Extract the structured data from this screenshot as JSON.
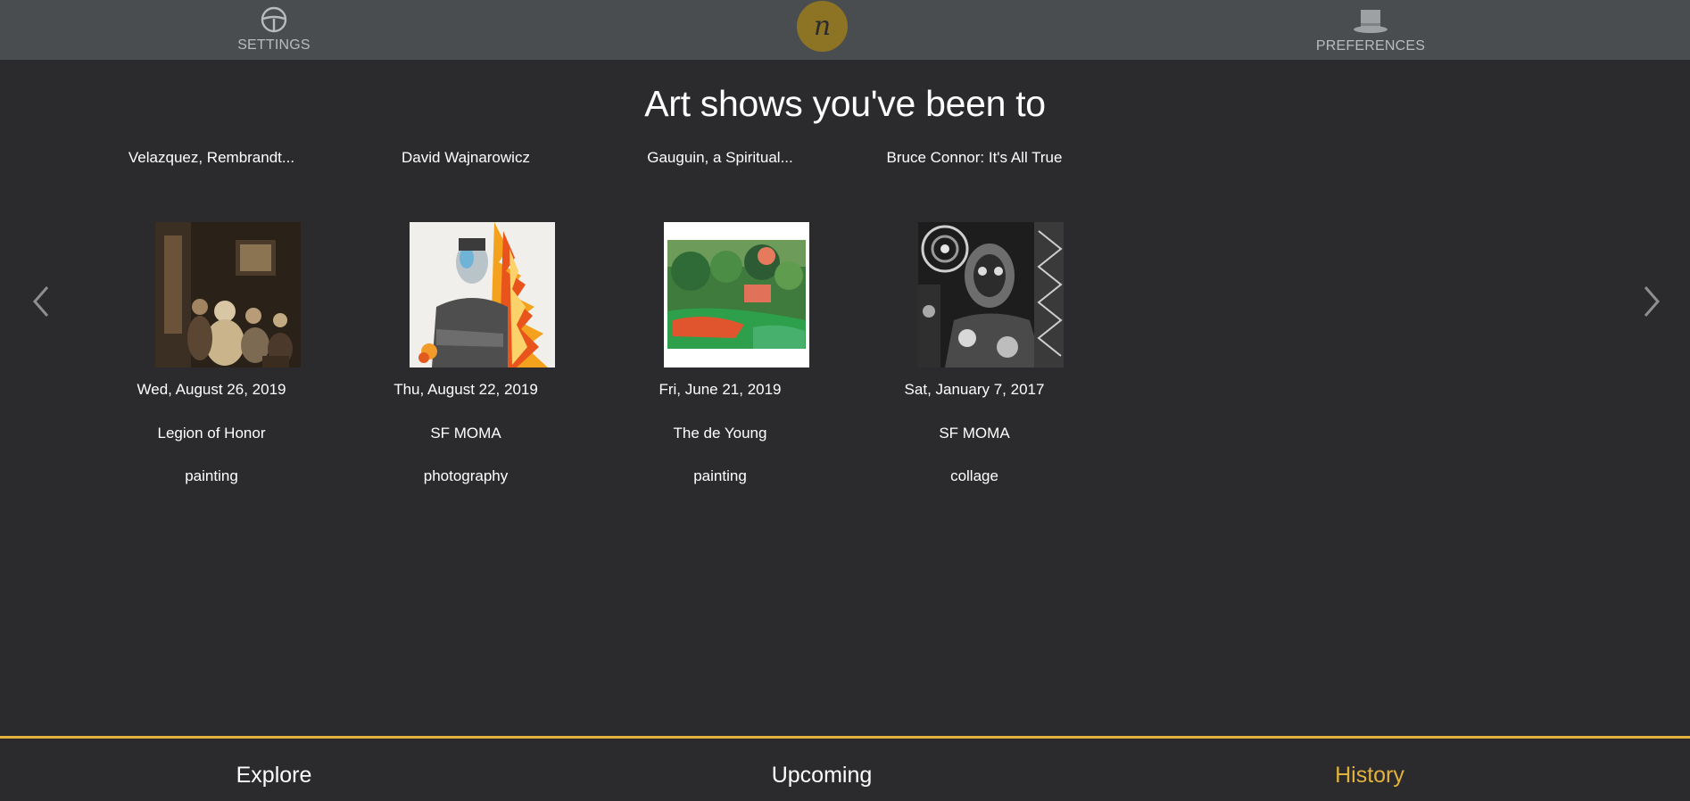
{
  "topbar": {
    "settings_label": "SETTINGS",
    "settings_icon": "steering-wheel-icon",
    "preferences_label": "PREFERENCES",
    "preferences_icon": "top-hat-icon",
    "logo_letter": "n",
    "logo_color": "#8d7425"
  },
  "page": {
    "title": "Art shows you've been to"
  },
  "carousel": {
    "prev_icon": "chevron-left-icon",
    "next_icon": "chevron-right-icon",
    "shows": [
      {
        "name": "Velazquez, Rembrandt...",
        "date": "Wed, August 26, 2019",
        "venue": "Legion of Honor",
        "medium": "painting"
      },
      {
        "name": "David Wajnarowicz",
        "date": "Thu, August 22, 2019",
        "venue": "SF MOMA",
        "medium": "photography"
      },
      {
        "name": "Gauguin, a Spiritual...",
        "date": "Fri, June 21, 2019",
        "venue": "The de Young",
        "medium": "painting"
      },
      {
        "name": "Bruce Connor: It's All True",
        "date": "Sat, January 7, 2017",
        "venue": "SF MOMA",
        "medium": "collage"
      }
    ]
  },
  "tabs": {
    "explore": "Explore",
    "upcoming": "Upcoming",
    "history": "History",
    "active": "History",
    "accent_color": "#e3b23c"
  }
}
